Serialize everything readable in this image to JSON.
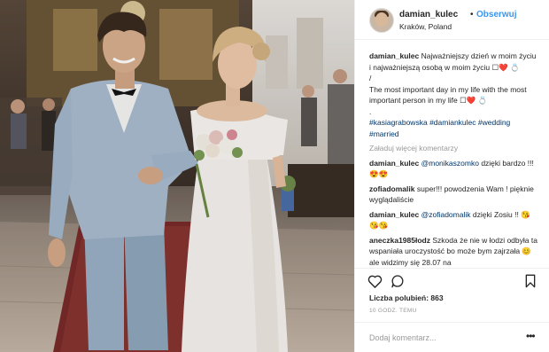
{
  "post": {
    "username": "damian_kulec",
    "separator": "•",
    "follow_label": "Obserwuj",
    "location": "Kraków, Poland"
  },
  "caption": {
    "author": "damian_kulec",
    "line_pl": "Najważniejszy dzień w moim życiu i najważniejszą osobą w moim życiu",
    "emoji_pl": "☐❤️ 💍",
    "slash": "/",
    "line_en": "The most important day in my life with the most important person in my life",
    "emoji_en": "☐❤️ 💍",
    "dot": ".",
    "tags": [
      "#kasiagrabowska",
      "#damiankulec",
      "#wedding",
      "#married"
    ]
  },
  "load_more_label": "Załaduj więcej komentarzy",
  "comments": [
    {
      "author": "damian_kulec",
      "mention": "@monikaszomko",
      "text": "dzięki bardzo !!! 😍😍"
    },
    {
      "author": "zofiadomalik",
      "mention": "",
      "text": "super!!! powodzenia Wam ! pięknie wyglądaliście"
    },
    {
      "author": "damian_kulec",
      "mention": "@zofiadomalik",
      "text": "dzięki Zosiu !! 😘😘😘"
    },
    {
      "author": "aneczka1985łodz",
      "mention": "",
      "text": "Szkoda że nie w łodzi odbyła ta wspaniała uroczystość bo może bym zajrzała 😊 ale widzimy się 28.07 na"
    }
  ],
  "likes_label": "Liczba polubień: 863",
  "time_label": "10 GODZ. TEMU",
  "add_comment_placeholder": "Dodaj komentarz...",
  "more_label": "•••",
  "icons": [
    "heart-icon",
    "comment-icon",
    "bookmark-icon"
  ],
  "colors": {
    "link": "#3897f0",
    "hashtag": "#003569",
    "muted": "#999999"
  }
}
